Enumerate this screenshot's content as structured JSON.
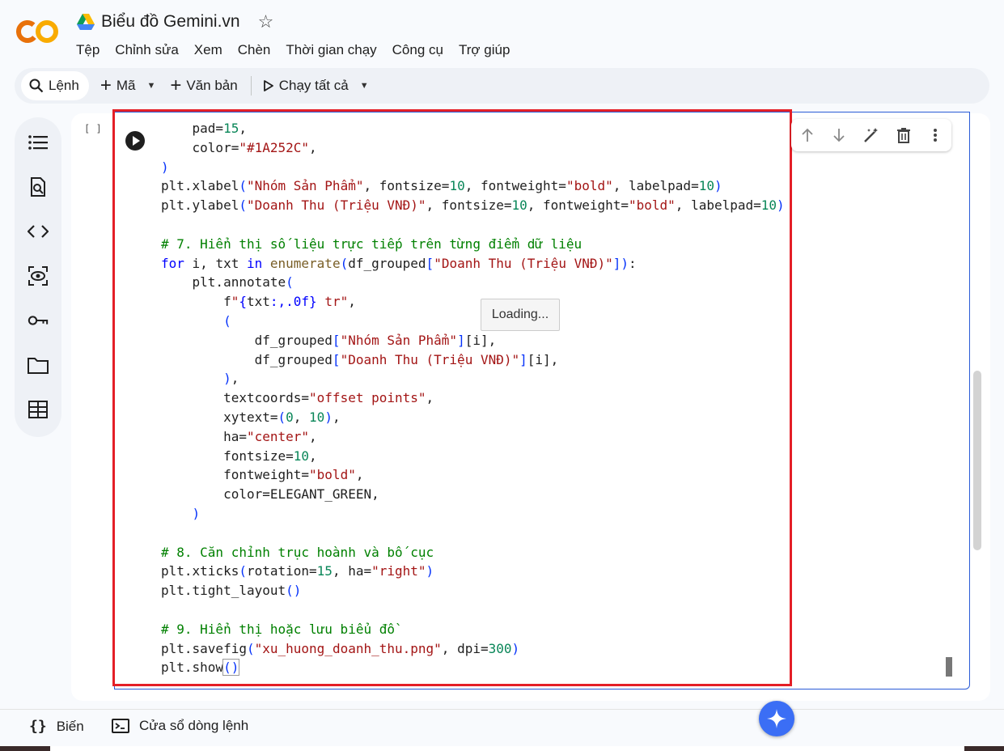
{
  "app": {
    "logo_text": "CO",
    "doc_title": "Biểu đồ Gemini.vn"
  },
  "menu": [
    "Tệp",
    "Chỉnh sửa",
    "Xem",
    "Chèn",
    "Thời gian chạy",
    "Công cụ",
    "Trợ giúp"
  ],
  "toolbar": {
    "command_label": "Lệnh",
    "code_label": "Mã",
    "text_label": "Văn bản",
    "run_all_label": "Chạy tất cả"
  },
  "sidebar": {
    "icons": [
      "table-of-contents-icon",
      "find-icon",
      "code-snippets-icon",
      "variables-inspector-icon",
      "secrets-key-icon",
      "files-folder-icon",
      "data-table-icon"
    ]
  },
  "cell": {
    "execution_count": "[ ]",
    "overlay_text": "Loading...",
    "code_lines": [
      "    pad=15,",
      "    color=\"#1A252C\",",
      ")",
      "plt.xlabel(\"Nhóm Sản Phẩm\", fontsize=10, fontweight=\"bold\", labelpad=10)",
      "plt.ylabel(\"Doanh Thu (Triệu VNĐ)\", fontsize=10, fontweight=\"bold\", labelpad=10)",
      "",
      "# 7. Hiển thị số liệu trực tiếp trên từng điểm dữ liệu",
      "for i, txt in enumerate(df_grouped[\"Doanh Thu (Triệu VNĐ)\"]):",
      "    plt.annotate(",
      "        f\"{txt:,.0f} tr\",",
      "        (",
      "            df_grouped[\"Nhóm Sản Phẩm\"][i],",
      "            df_grouped[\"Doanh Thu (Triệu VNĐ)\"][i],",
      "        ),",
      "        textcoords=\"offset points\",",
      "        xytext=(0, 10),",
      "        ha=\"center\",",
      "        fontsize=10,",
      "        fontweight=\"bold\",",
      "        color=ELEGANT_GREEN,",
      "    )",
      "",
      "# 8. Căn chỉnh trục hoành và bố cục",
      "plt.xticks(rotation=15, ha=\"right\")",
      "plt.tight_layout()",
      "",
      "# 9. Hiển thị hoặc lưu biểu đồ",
      "plt.savefig(\"xu_huong_doanh_thu.png\", dpi=300)",
      "plt.show()"
    ]
  },
  "cell_toolbar": {
    "icons": [
      "move-up-icon",
      "move-down-icon",
      "magic-edit-icon",
      "delete-icon",
      "more-icon"
    ]
  },
  "status": {
    "variables_label": "Biến",
    "terminal_label": "Cửa sổ dòng lệnh"
  },
  "colors": {
    "highlight": "#e41f27",
    "cell_border": "#2a5bd7",
    "gemini": "#3b6ef5",
    "logo_orange": "#f9ab00",
    "logo_dark_orange": "#e8710a"
  }
}
